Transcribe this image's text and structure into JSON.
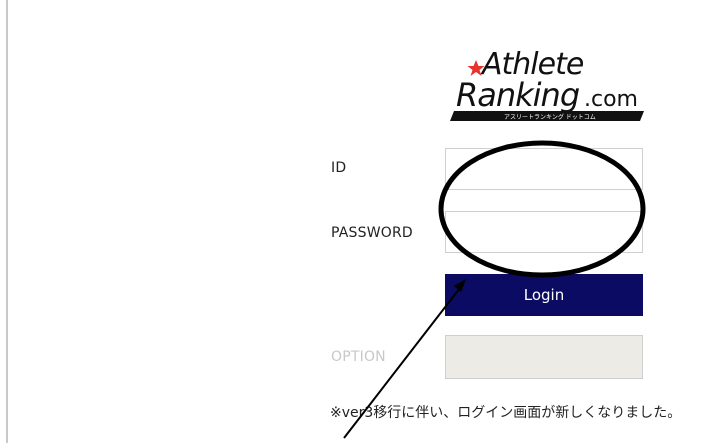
{
  "logo": {
    "line1": "Athlete",
    "line2": "Ranking",
    "suffix": ".com",
    "tagline": "アスリートランキング ドットコム"
  },
  "form": {
    "id_label": "ID",
    "id_value": "",
    "password_label": "PASSWORD",
    "password_value": "",
    "login_label": "Login",
    "option_label": "OPTION"
  },
  "note": "※ver3移行に伴い、ログイン画面が新しくなりました。",
  "colors": {
    "login_button": "#0b0b63",
    "option_box": "#ecebe6",
    "annotation": "#000000"
  },
  "annotations": {
    "circle": "ellipse-around-id-password-fields",
    "arrow": "arrow-pointing-to-login-button"
  }
}
